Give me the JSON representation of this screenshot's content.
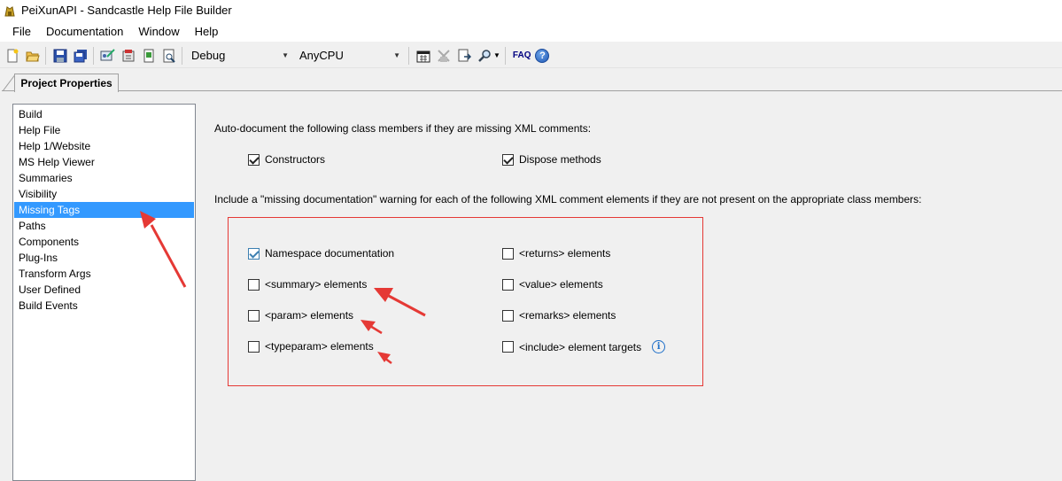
{
  "window": {
    "title": "PeiXunAPI - Sandcastle Help File Builder"
  },
  "menu": [
    "File",
    "Documentation",
    "Window",
    "Help"
  ],
  "toolbar": {
    "configuration": "Debug",
    "platform": "AnyCPU",
    "faq_label": "FAQ"
  },
  "tabs": {
    "active": "Project Properties"
  },
  "sidebar": {
    "items": [
      "Build",
      "Help File",
      "Help 1/Website",
      "MS Help Viewer",
      "Summaries",
      "Visibility",
      "Missing Tags",
      "Paths",
      "Components",
      "Plug-Ins",
      "Transform Args",
      "User Defined",
      "Build Events"
    ],
    "selected": "Missing Tags"
  },
  "main": {
    "auto_doc_label": "Auto-document the following class members if they are missing XML comments:",
    "constructors": {
      "label": "Constructors",
      "checked": true
    },
    "dispose_methods": {
      "label": "Dispose methods",
      "checked": true
    },
    "warning_label": "Include a \"missing documentation\" warning for each of the following XML comment elements if they are not present on the appropriate class members:",
    "checks": {
      "namespace": {
        "label": "Namespace documentation",
        "checked": true
      },
      "summary": {
        "label": "<summary> elements",
        "checked": false
      },
      "param": {
        "label": "<param> elements",
        "checked": false
      },
      "typeparam": {
        "label": "<typeparam> elements",
        "checked": false
      },
      "returns": {
        "label": "<returns> elements",
        "checked": false
      },
      "value": {
        "label": "<value> elements",
        "checked": false
      },
      "remarks": {
        "label": "<remarks> elements",
        "checked": false
      },
      "include": {
        "label": "<include> element targets",
        "checked": false
      }
    }
  },
  "colors": {
    "selection": "#3399ff",
    "annotation": "#e53935",
    "info": "#1e6fc9"
  }
}
